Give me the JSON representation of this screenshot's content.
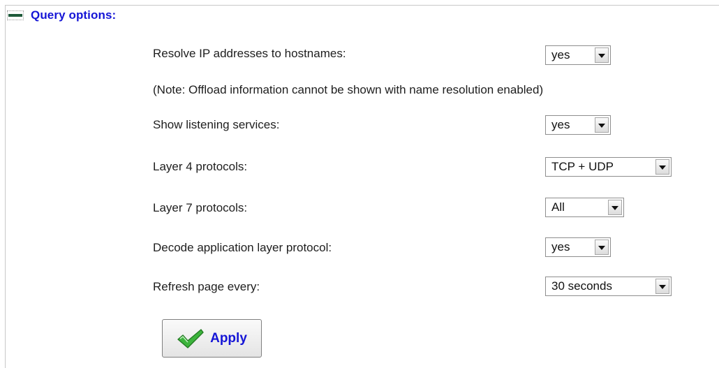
{
  "header": {
    "title": "Query options:",
    "icon": "collapse-icon"
  },
  "rows": {
    "resolve_ip": {
      "label": "Resolve IP addresses to hostnames:",
      "value": "yes"
    },
    "note": "(Note: Offload information cannot be shown with name resolution enabled)",
    "listening": {
      "label": "Show listening services:",
      "value": "yes"
    },
    "layer4": {
      "label": "Layer 4 protocols:",
      "value": "TCP + UDP"
    },
    "layer7": {
      "label": "Layer 7 protocols:",
      "value": "All"
    },
    "decode": {
      "label": "Decode application layer protocol:",
      "value": "yes"
    },
    "refresh": {
      "label": "Refresh page every:",
      "value": "30 seconds"
    }
  },
  "apply": {
    "label": "Apply",
    "icon": "checkmark-icon"
  },
  "colors": {
    "accent_blue": "#1515d6",
    "icon_green": "#1e5a3a",
    "check_green": "#3cb43c"
  }
}
